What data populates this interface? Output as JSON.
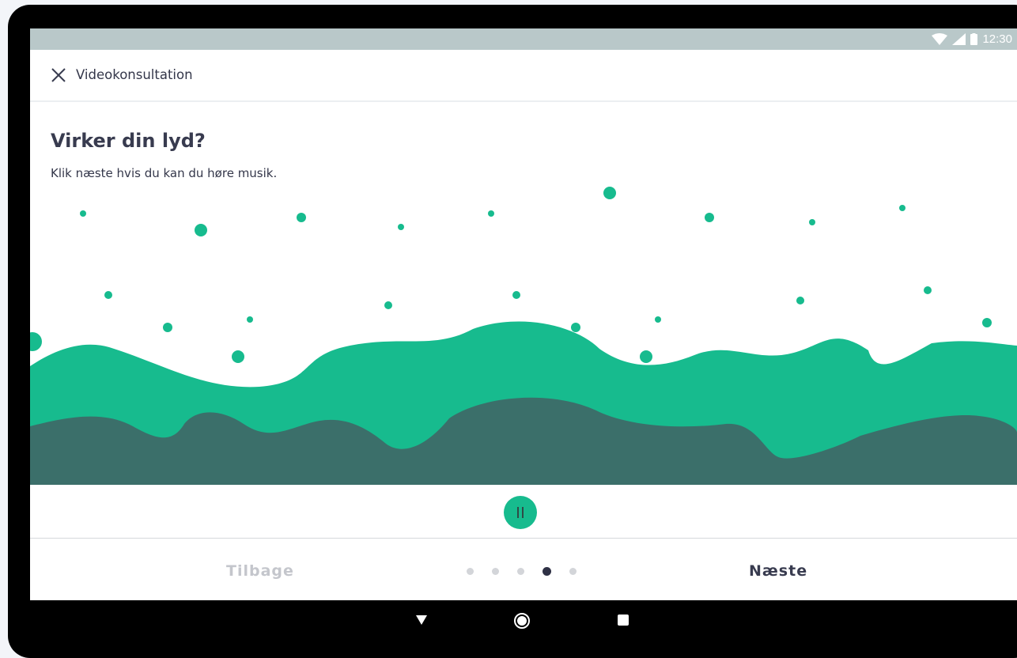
{
  "status_bar": {
    "time": "12:30",
    "icons": [
      "wifi-icon",
      "signal-icon",
      "battery-icon"
    ],
    "background": "#b9c8c9"
  },
  "app_bar": {
    "close_icon": "close-icon",
    "title": "Videokonsultation"
  },
  "content": {
    "heading": "Virker din lyd?",
    "instruction": "Klik næste hvis du kan du høre musik."
  },
  "visualizer": {
    "colors": {
      "front_wave": "#17bb8e",
      "back_wave": "#3b6f6a",
      "particles": "#17bb8e"
    }
  },
  "player": {
    "state": "playing",
    "button_icon": "pause-icon",
    "accent": "#17bb8e"
  },
  "footer": {
    "back_label": "Tilbage",
    "next_label": "Næste",
    "steps_total": 5,
    "current_step": 4
  },
  "system_nav": {
    "icons": [
      "back-icon",
      "home-icon",
      "recents-icon"
    ]
  }
}
